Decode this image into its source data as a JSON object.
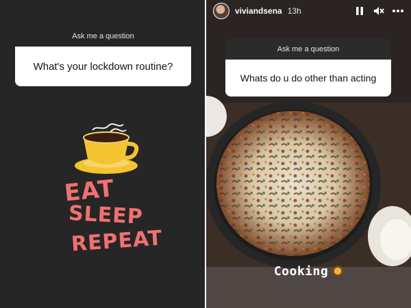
{
  "left_story": {
    "question_title": "Ask me a question",
    "question_text": "What's your lockdown routine?",
    "sticker_lines": [
      "EAT",
      "SLEEP",
      "REPEAT"
    ],
    "background_color": "#262626",
    "sticker_color": "#f07170",
    "cup_color": "#f4c430"
  },
  "right_story": {
    "username": "viviandsena",
    "timestamp": "13h",
    "icons": [
      "pause-icon",
      "mute-icon",
      "more-icon"
    ],
    "question_title": "Ask me a question",
    "question_text": "Whats do u do other than acting",
    "caption": "Cooking",
    "caption_emoji": "cooking-emoji"
  }
}
